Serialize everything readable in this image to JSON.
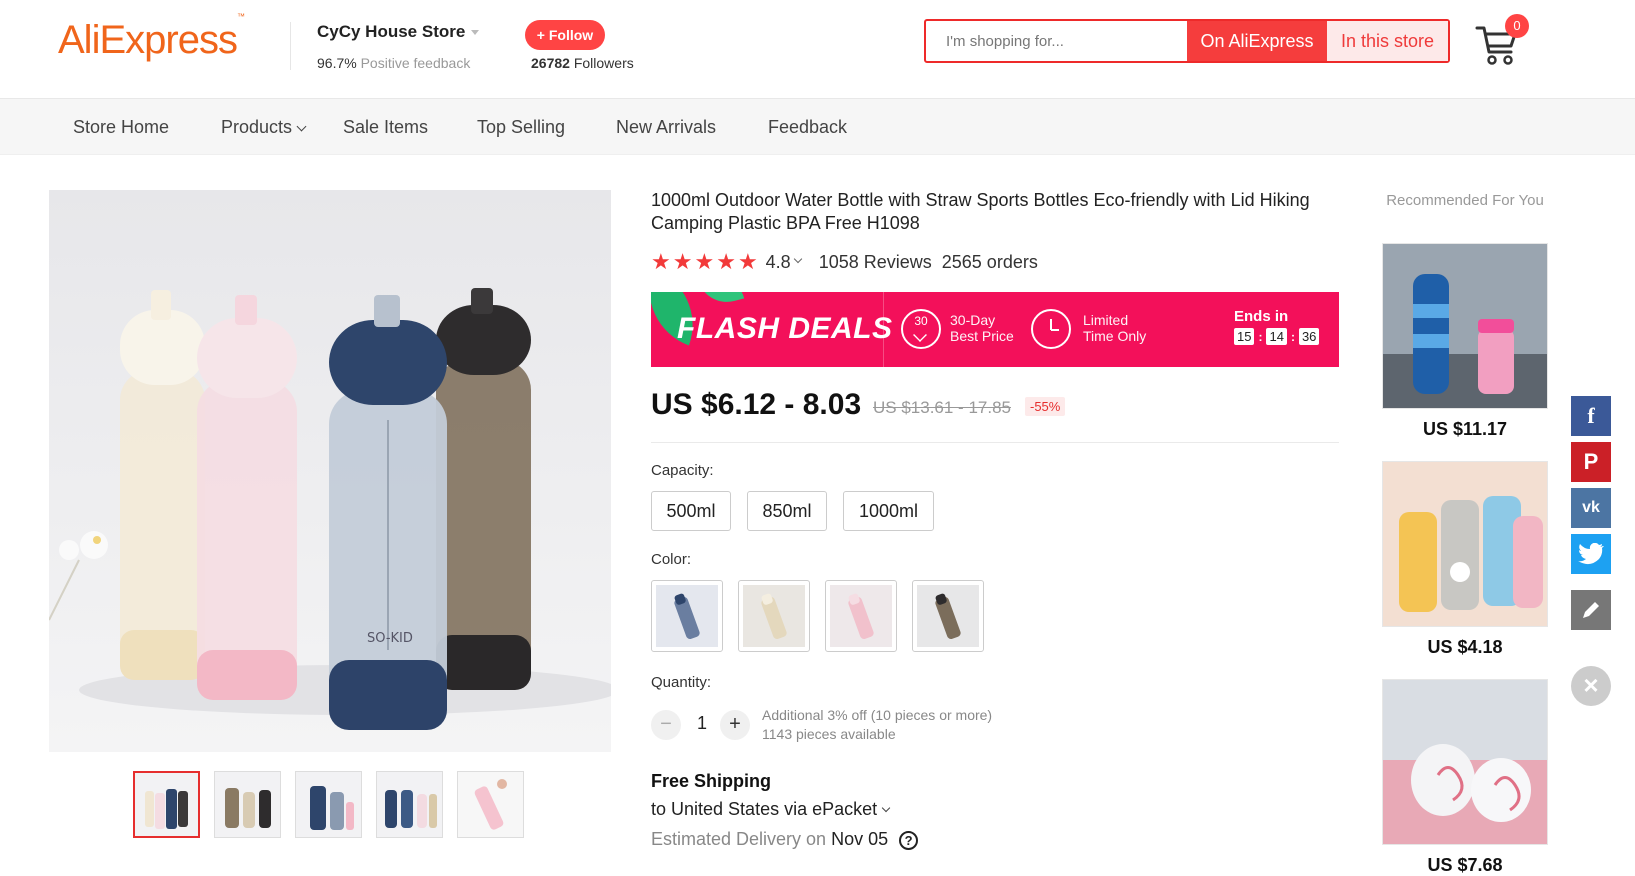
{
  "header": {
    "logo_ali": "Ali",
    "logo_express": "Express",
    "logo_tm": "™",
    "store_name": "CyCy House Store",
    "feedback_pct": "96.7%",
    "feedback_label": "Positive feedback",
    "follow_label": "+ Follow",
    "followers_count": "26782",
    "followers_label": "Followers",
    "search_placeholder": "I'm shopping for...",
    "search_btn_ali": "On AliExpress",
    "search_btn_store": "In this store",
    "cart_count": "0"
  },
  "nav": {
    "items": [
      "Store Home",
      "Products",
      "Sale Items",
      "Top Selling",
      "New Arrivals",
      "Feedback"
    ]
  },
  "product": {
    "title": "1000ml Outdoor Water Bottle with Straw Sports Bottles Eco-friendly with Lid Hiking Camping Plastic BPA Free H1098",
    "rating": "4.8",
    "rating_stars": 5,
    "reviews": "1058 Reviews",
    "orders": "2565 orders",
    "flash": {
      "title": "FLASH DEALS",
      "badge_num": "30",
      "feat1_line1": "30-Day",
      "feat1_line2": "Best Price",
      "feat2_line1": "Limited",
      "feat2_line2": "Time Only",
      "ends_label": "Ends in",
      "hours": "15",
      "minutes": "14",
      "seconds": "36"
    },
    "price": "US $6.12 - 8.03",
    "original_price": "US $13.61 - 17.85",
    "discount": "-55%",
    "capacity_label": "Capacity:",
    "capacities": [
      "500ml",
      "850ml",
      "1000ml"
    ],
    "color_label": "Color:",
    "quantity_label": "Quantity:",
    "quantity": "1",
    "qty_minus": "−",
    "qty_plus": "+",
    "qty_note1": "Additional 3% off (10 pieces or more)",
    "qty_note2": "1143 pieces available",
    "shipping_title": "Free Shipping",
    "shipping_to": "to United States via ePacket",
    "delivery_label": "Estimated Delivery on",
    "delivery_date": "Nov 05",
    "help_glyph": "?"
  },
  "recommended": {
    "title": "Recommended For You",
    "items": [
      {
        "price": "US $11.17"
      },
      {
        "price": "US $4.18"
      },
      {
        "price": "US $7.68"
      }
    ]
  },
  "social": {
    "facebook": "f",
    "pinterest": "P",
    "vk": "vk",
    "close": "×"
  },
  "colors": {
    "accent": "#f53d3d",
    "flash": "#f3105a",
    "facebook": "#3b5998",
    "pinterest": "#cb2027",
    "vk": "#4c75a3",
    "twitter": "#1da1f2",
    "edit": "#777777"
  }
}
